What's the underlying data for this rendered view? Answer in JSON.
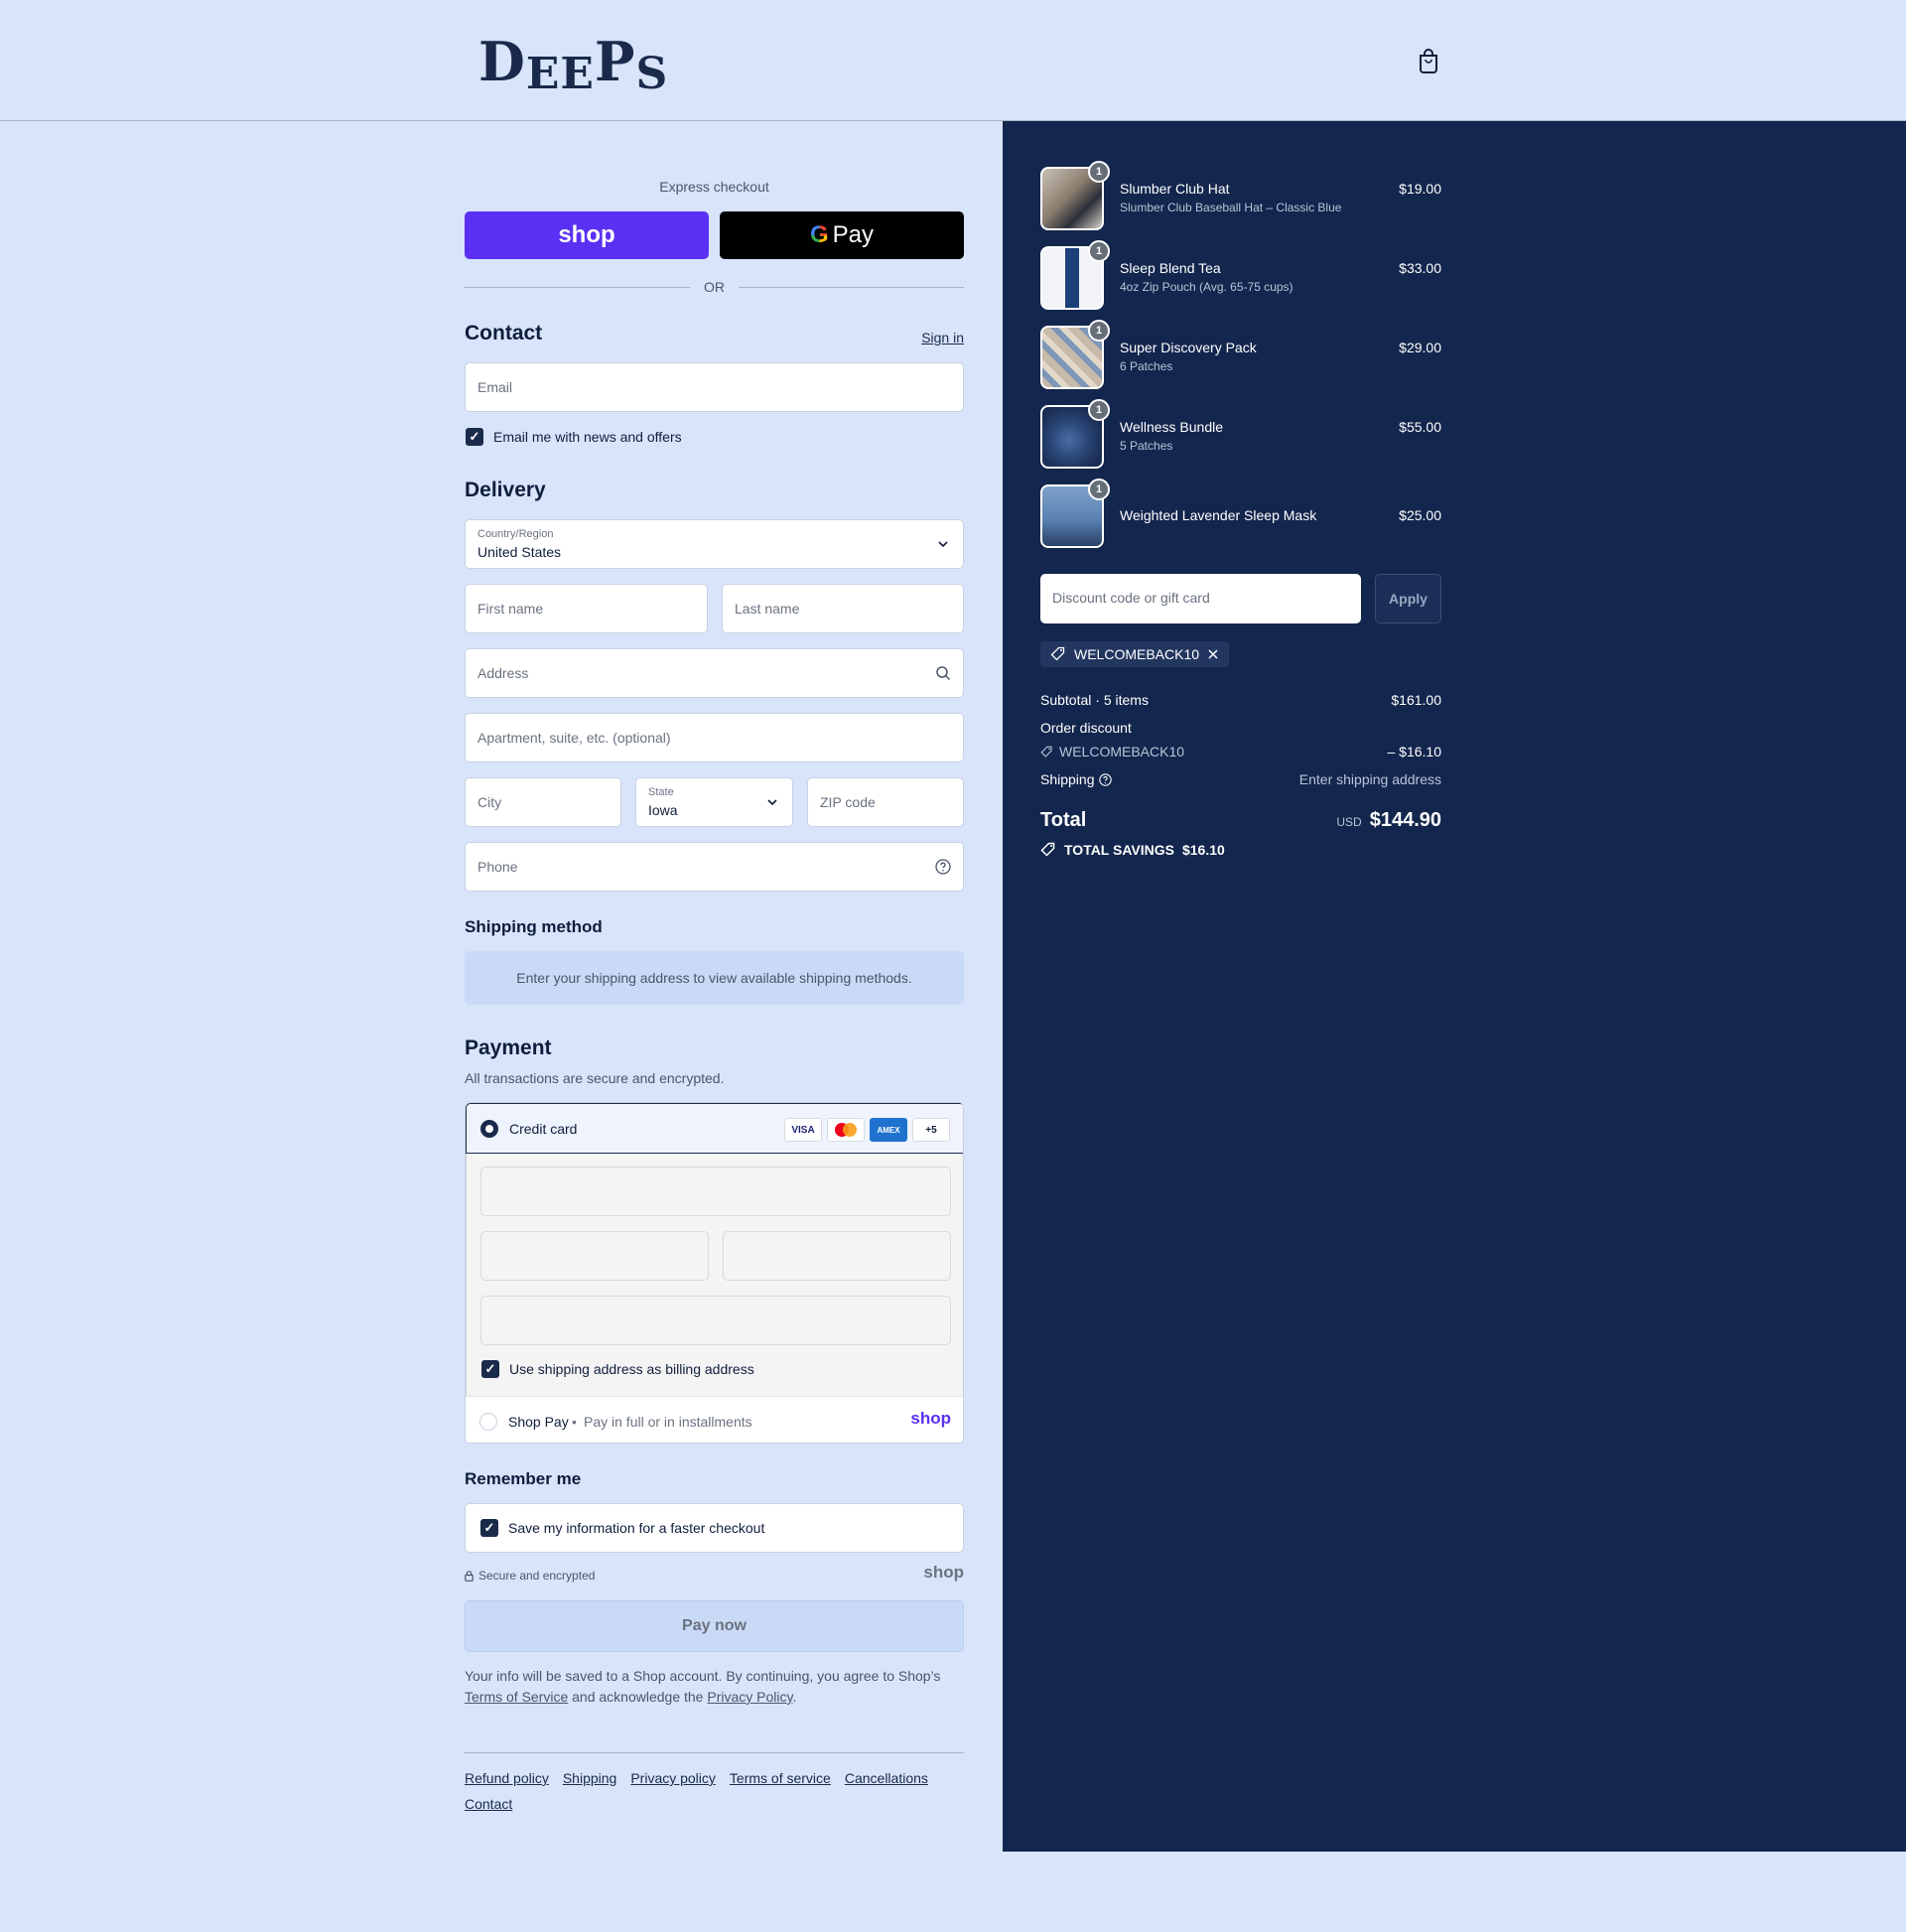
{
  "header": {
    "brand": "DEEPS",
    "cart_icon": "shopping-bag-icon"
  },
  "express": {
    "label": "Express checkout",
    "shop_button": "shop",
    "gpay_button": "Pay",
    "or_label": "OR"
  },
  "contact": {
    "title": "Contact",
    "sign_in": "Sign in",
    "email_placeholder": "Email",
    "newsletter_label": "Email me with news and offers",
    "newsletter_checked": true
  },
  "delivery": {
    "title": "Delivery",
    "country_label": "Country/Region",
    "country_value": "United States",
    "first_name_placeholder": "First name",
    "last_name_placeholder": "Last name",
    "address_placeholder": "Address",
    "apartment_placeholder": "Apartment, suite, etc. (optional)",
    "city_placeholder": "City",
    "state_label": "State",
    "state_value": "Iowa",
    "zip_placeholder": "ZIP code",
    "phone_placeholder": "Phone"
  },
  "shipping_method": {
    "title": "Shipping method",
    "note": "Enter your shipping address to view available shipping methods."
  },
  "payment": {
    "title": "Payment",
    "subtitle": "All transactions are secure and encrypted.",
    "credit_card_label": "Credit card",
    "card_logos": [
      "VISA",
      "Mastercard",
      "AMEX",
      "+5"
    ],
    "billing_same_label": "Use shipping address as billing address",
    "billing_same_checked": true,
    "shop_pay_label": "Shop Pay",
    "shop_pay_sub": "Pay in full or in installments",
    "shop_pay_logo": "shop"
  },
  "remember": {
    "title": "Remember me",
    "save_label": "Save my information for a faster checkout",
    "save_checked": true,
    "secure_label": "Secure and encrypted",
    "shop_logo": "shop"
  },
  "pay_now": "Pay now",
  "legal": {
    "text_before": "Your info will be saved to a Shop account. By continuing, you agree to Shop’s ",
    "terms_link": "Terms of Service",
    "text_middle": " and acknowledge the ",
    "privacy_link": "Privacy Policy",
    "text_after": "."
  },
  "footer_links": [
    "Refund policy",
    "Shipping",
    "Privacy policy",
    "Terms of service",
    "Cancellations",
    "Contact"
  ],
  "order": {
    "items": [
      {
        "name": "Slumber Club Hat",
        "variant": "Slumber Club Baseball Hat – Classic Blue",
        "price": "$19.00",
        "qty": "1"
      },
      {
        "name": "Sleep Blend Tea",
        "variant": "4oz Zip Pouch (Avg. 65-75 cups)",
        "price": "$33.00",
        "qty": "1"
      },
      {
        "name": "Super Discovery Pack",
        "variant": "6 Patches",
        "price": "$29.00",
        "qty": "1"
      },
      {
        "name": "Wellness Bundle",
        "variant": "5 Patches",
        "price": "$55.00",
        "qty": "1"
      },
      {
        "name": "Weighted Lavender Sleep Mask",
        "variant": "",
        "price": "$25.00",
        "qty": "1"
      }
    ],
    "discount_placeholder": "Discount code or gift card",
    "apply_label": "Apply",
    "applied_code": "WELCOMEBACK10",
    "subtotal_label": "Subtotal · 5 items",
    "subtotal_value": "$161.00",
    "order_discount_label": "Order discount",
    "order_discount_code": "WELCOMEBACK10",
    "order_discount_value": "– $16.10",
    "shipping_label": "Shipping",
    "shipping_value": "Enter shipping address",
    "total_label": "Total",
    "currency": "USD",
    "total_value": "$144.90",
    "savings_label": "TOTAL SAVINGS",
    "savings_value": "$16.10"
  },
  "colors": {
    "page_bg": "#d8e4fa",
    "summary_bg": "#13264d",
    "shop_purple": "#5a31f4",
    "primary": "#1a2a4a"
  }
}
